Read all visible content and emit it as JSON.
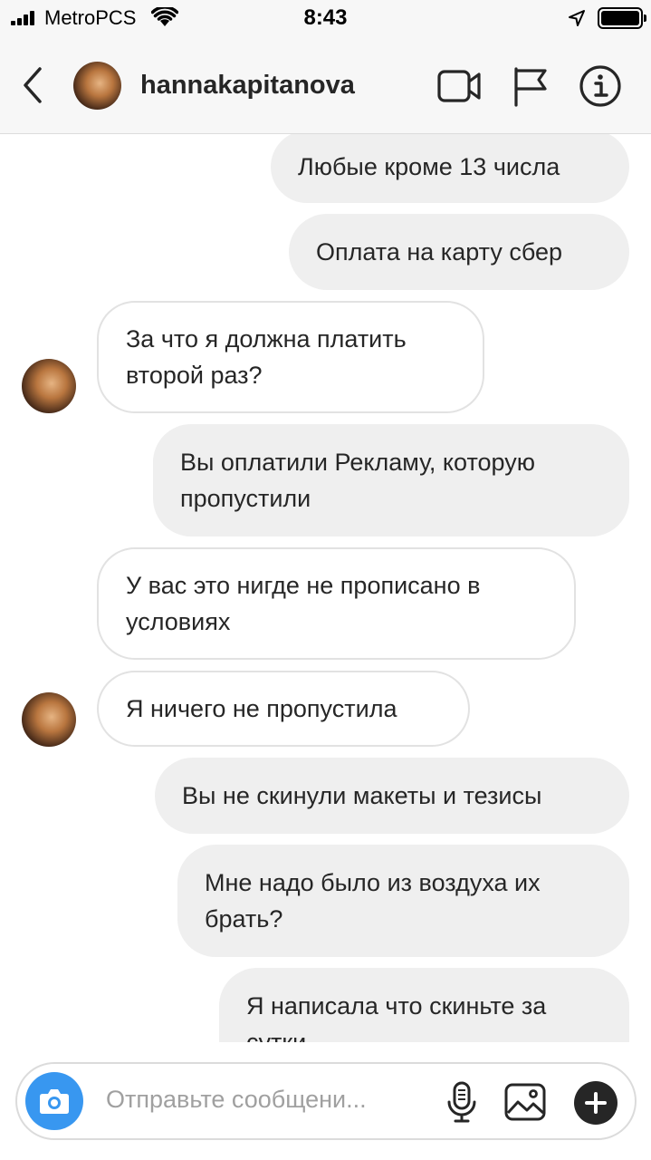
{
  "status_bar": {
    "carrier": "MetroPCS",
    "time": "8:43"
  },
  "header": {
    "username": "hannakapitanova",
    "icons": [
      "back-chevron-icon",
      "video-camera-icon",
      "flag-icon",
      "info-icon"
    ]
  },
  "messages": [
    {
      "direction": "outgoing",
      "lines": [
        "Любые кроме 13 числа"
      ]
    },
    {
      "direction": "outgoing",
      "lines": [
        "Оплата на карту сбер"
      ]
    },
    {
      "direction": "incoming",
      "lines": [
        "За что я должна платить",
        "второй раз?"
      ]
    },
    {
      "direction": "outgoing",
      "lines": [
        "Вы оплатили Рекламу, которую",
        "пропустили"
      ]
    },
    {
      "direction": "incoming",
      "lines": [
        "У вас это нигде не прописано в",
        "условиях"
      ]
    },
    {
      "direction": "incoming",
      "lines": [
        "Я ничего не пропустила"
      ]
    },
    {
      "direction": "outgoing",
      "lines": [
        "Вы не скинули макеты и тезисы"
      ]
    },
    {
      "direction": "outgoing",
      "lines": [
        "Мне надо было из воздуха их",
        "брать?"
      ]
    },
    {
      "direction": "outgoing",
      "lines": [
        "Я написала что скиньте за",
        "сутки"
      ]
    }
  ],
  "composer": {
    "placeholder": "Отправьте сообщени...",
    "icons": [
      "camera-icon",
      "microphone-icon",
      "gallery-icon",
      "plus-icon"
    ]
  },
  "colors": {
    "accent": "#3897f0",
    "outgoing_bubble": "#efefef",
    "incoming_border": "#e2e2e2",
    "header_bg": "#f7f7f7"
  }
}
